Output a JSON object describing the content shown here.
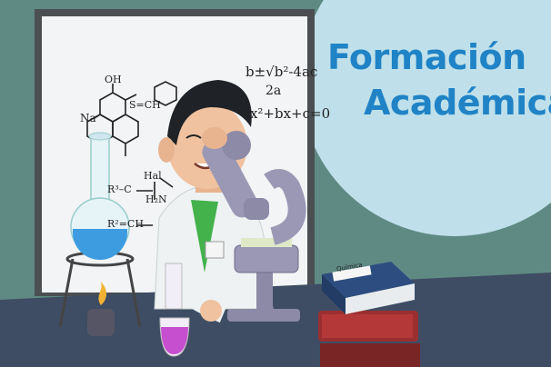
{
  "banner": {
    "title_line1": "Formación",
    "title_line2": "Académica"
  },
  "whiteboard": {
    "formula_quadratic_numerator": "b±√b²-4ac",
    "formula_quadratic_denominator": "2a",
    "formula_polynomial": "ax²+bx+c=0",
    "chem_label_oh": "OH",
    "chem_label_na": "Na",
    "chem_label_s_ch": "S=CH",
    "chem_label_hal": "Hal",
    "chem_label_r3_ch": "R³–C",
    "chem_label_h2n": "H₂N",
    "chem_label_r2_ch": "R²=CH"
  },
  "book": {
    "spine_label": "Química"
  },
  "colors": {
    "title": "#1f83c6",
    "circle": "#bfe0ea",
    "wall": "#5f8a84",
    "desk": "#3e4d63",
    "flask_liquid": "#3d9be0",
    "tube_liquid": "#c64fcf"
  }
}
